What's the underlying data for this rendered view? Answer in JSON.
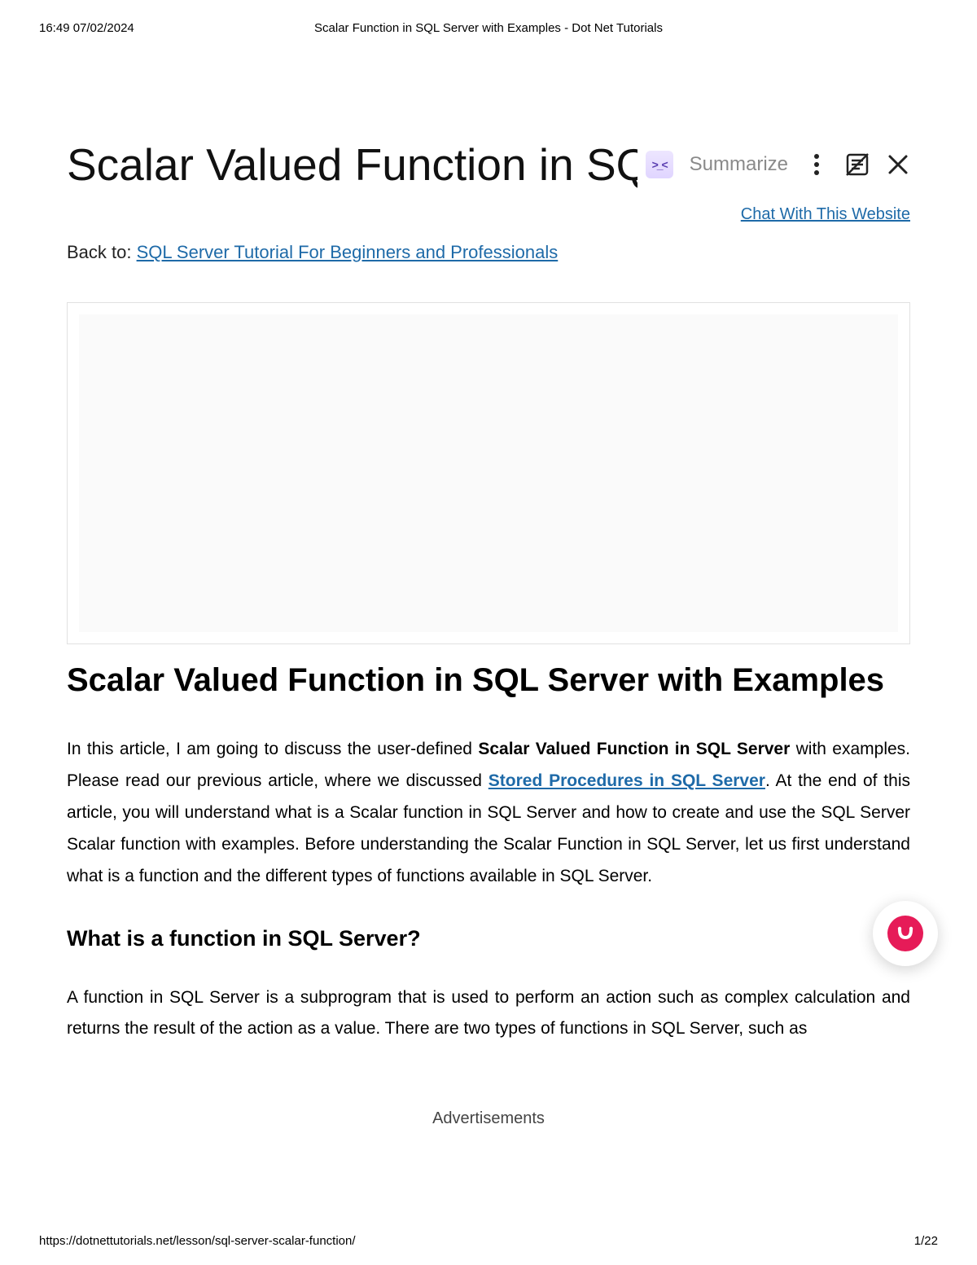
{
  "print": {
    "time": "16:49 07/02/2024",
    "title": "Scalar Function in SQL Server with Examples - Dot Net Tutorials",
    "url": "https://dotnettutorials.net/lesson/sql-server-scalar-function/",
    "page": "1/22"
  },
  "header": {
    "page_title": "Scalar Valued Function in SQL Serve",
    "summarize": "Summarize",
    "chat_link": "Chat With This Website"
  },
  "backto": {
    "label": "Back to: ",
    "link_text": "SQL Server Tutorial For Beginners and Professionals"
  },
  "article": {
    "h1": "Scalar Valued Function in SQL Server with Examples",
    "p1_part1": "In this article, I am going to discuss the user-defined ",
    "p1_bold": "Scalar Valued Function in SQL Server",
    "p1_part2": " with examples. Please read our previous article, where we discussed ",
    "p1_link": "Stored Procedures in SQL Server",
    "p1_part3": ". At the end of this article, you will understand what is a Scalar function in SQL Server and how to create and use the SQL Server Scalar function with examples. Before understanding the Scalar Function in SQL Server, let us first understand what is a function and the different types of functions available in SQL Server.",
    "h2": "What is a function in SQL Server?",
    "p2": "A function in SQL Server is a subprogram that is used to perform an action such as complex calculation and returns the result of the action as a value. There are two types of functions in SQL Server, such as",
    "ads_label": "Advertisements"
  }
}
